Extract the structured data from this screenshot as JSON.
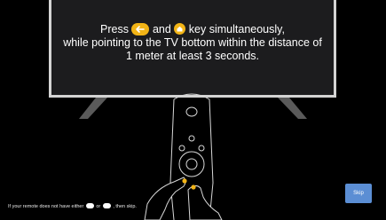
{
  "instruction": {
    "line1_press": "Press",
    "line1_and": "and",
    "line1_rest": "key simultaneously,",
    "line2": "while pointing to the TV bottom within the distance of",
    "line3": "1 meter at least 3 seconds."
  },
  "icons": {
    "back_key": "back-arrow-icon",
    "home_key": "home-icon",
    "accent_color": "#f2b416"
  },
  "footer": {
    "hint_prefix": "If your remote does not have either",
    "hint_or": "or",
    "hint_suffix": ", then skip."
  },
  "skip_button": {
    "label": "Skip",
    "color": "#5b8ed4"
  }
}
